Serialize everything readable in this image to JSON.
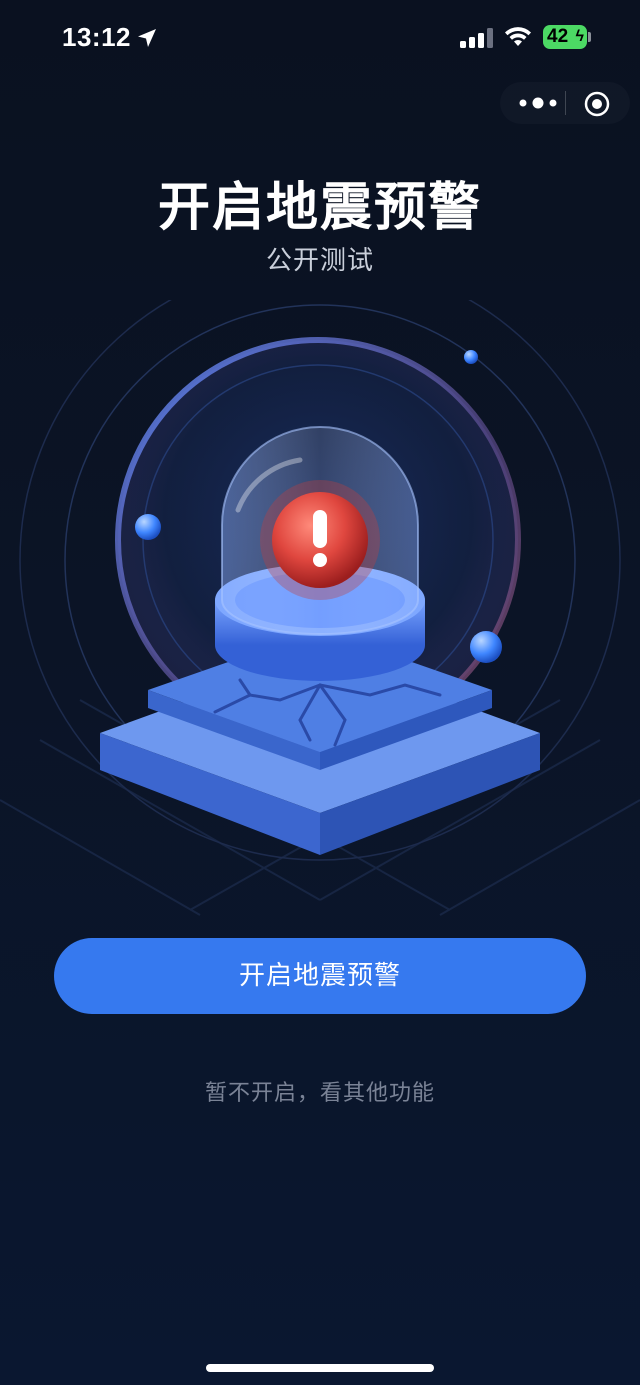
{
  "status_bar": {
    "time": "13:12",
    "battery": "42"
  },
  "page": {
    "title": "开启地震预警",
    "subtitle": "公开测试"
  },
  "actions": {
    "primary_button": "开启地震预警",
    "skip_link": "暂不开启，看其他功能"
  },
  "icons": [
    "location-arrow-icon",
    "signal-icon",
    "wifi-icon",
    "battery-icon",
    "more-icon",
    "close-target-icon",
    "alarm-icon"
  ],
  "colors": {
    "background": "#0b1426",
    "primary": "#3679ef",
    "alarm": "#e0473f",
    "platform": "#4c7fe0",
    "skip_text": "#7a8396"
  }
}
